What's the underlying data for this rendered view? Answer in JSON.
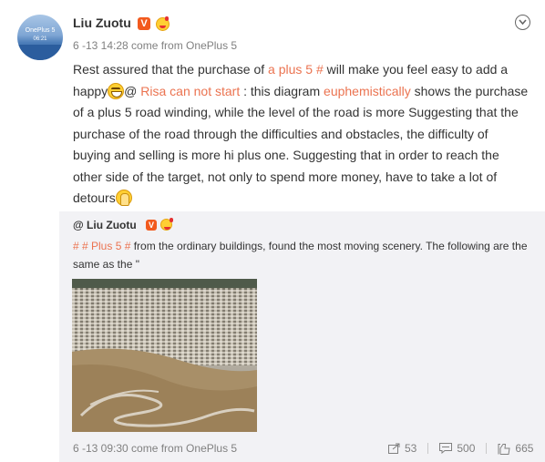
{
  "user": {
    "name": "Liu Zuotu",
    "avatar_brand": "OnePlus 5",
    "avatar_time": "06:21",
    "verified_mark": "V"
  },
  "post": {
    "meta": "6 -13 14:28 come from OnePlus 5",
    "seg1": "Rest assured that the purchase of ",
    "link1": "a plus 5 #",
    "seg2": " will make you feel easy to add a happy",
    "seg3": "@ ",
    "link2": "Risa can not start",
    "seg4": " : this diagram ",
    "link3": "euphemistically",
    "seg5": " shows the purchase of a plus 5 road winding, while the level of the road is more Suggesting that the purchase of the road through the difficulties and obstacles, the difficulty of buying and selling is more hi plus one. Suggesting that in order to reach the other side of the target, not only to spend more money, have to take a lot of detours"
  },
  "repost": {
    "user": "@ Liu Zuotu",
    "verified_mark": "V",
    "tag": "# # Plus 5 #",
    "text": " from the ordinary buildings, found the most moving scenery. The following are the same as the \"",
    "meta": "6 -13 09:30 come from OnePlus 5",
    "forward_count": "53",
    "comment_count": "500",
    "like_count": "665"
  },
  "icons": {
    "menu": "chevron-down-circle-icon",
    "forward": "share-icon",
    "comment": "comment-icon",
    "like": "thumbs-up-icon"
  },
  "colors": {
    "link": "#eb7350",
    "badge": "#f25a1e",
    "repost_bg": "#f2f2f5"
  }
}
